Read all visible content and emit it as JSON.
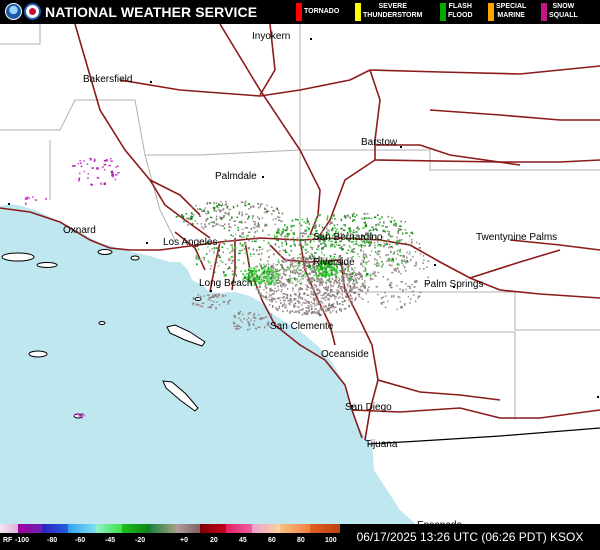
{
  "header": {
    "agency_title": "NATIONAL WEATHER SERVICE",
    "logos": [
      "noaa-logo",
      "nws-logo"
    ],
    "warning_legend": [
      {
        "label": "TORNADO",
        "color": "#ff0000"
      },
      {
        "label": "SEVERE\nTHUNDERSTORM",
        "color": "#ffff00"
      },
      {
        "label": "FLASH\nFLOOD",
        "color": "#00aa00"
      },
      {
        "label": "SPECIAL\nMARINE",
        "color": "#ffa500"
      },
      {
        "label": "SNOW\nSQUALL",
        "color": "#c71585"
      }
    ]
  },
  "map": {
    "cities": [
      {
        "name": "Inyokern"
      },
      {
        "name": "Bakersfield"
      },
      {
        "name": "Barstow"
      },
      {
        "name": "Palmdale"
      },
      {
        "name": "Oxnard"
      },
      {
        "name": "Los Angeles"
      },
      {
        "name": "San Bernardino"
      },
      {
        "name": "Twentynine Palms"
      },
      {
        "name": "Riverside"
      },
      {
        "name": "Long Beach"
      },
      {
        "name": "Palm Springs"
      },
      {
        "name": "San Clemente"
      },
      {
        "name": "Oceanside"
      },
      {
        "name": "San Diego"
      },
      {
        "name": "Tijuana"
      },
      {
        "name": "Ensenada"
      }
    ],
    "colors": {
      "ocean": "#bfe7ef",
      "land": "#ffffff",
      "highway": "#8b1a1a",
      "county_line": "#b0b0b0",
      "border": "#000000"
    }
  },
  "colorbar": {
    "ticks": [
      "RF",
      "-100",
      "-80",
      "-60",
      "-45",
      "-20",
      "+0",
      "20",
      "45",
      "60",
      "80",
      "100"
    ]
  },
  "timestamp": "06/17/2025 13:26 UTC (06:26 PDT) KSOX"
}
